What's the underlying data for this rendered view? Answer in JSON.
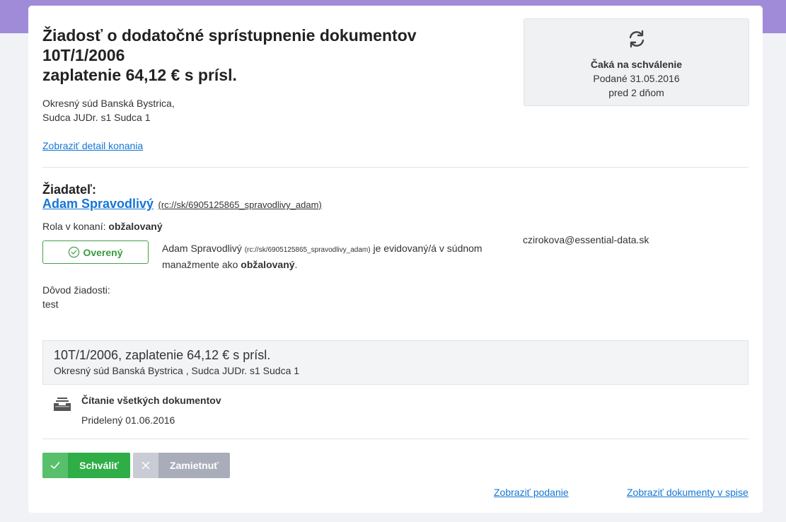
{
  "request": {
    "title_lines": [
      "Žiadosť o dodatočné sprístupnenie dokumentov",
      "10T/1/2006",
      "zaplatenie 64,12 € s prísl."
    ],
    "court_lines": [
      "Okresný súd Banská Bystrica,",
      "Sudca JUDr. s1 Sudca 1"
    ],
    "detail_link": "Zobraziť detail konania"
  },
  "status": {
    "icon": "refresh-icon",
    "title": "Čaká na schválenie",
    "date": "Podané 31.05.2016",
    "ago": "pred 2 dňom"
  },
  "applicant": {
    "heading": "Žiadateľ:",
    "name": "Adam Spravodlivý",
    "id": "(rc://sk/6905125865_spravodlivy_adam)",
    "role_label": "Rola v konaní:",
    "role_value": "obžalovaný",
    "verified_label": "Overený",
    "verified_color": "#46a049",
    "verify_name": "Adam Spravodlivý",
    "verify_id": "(rc://sk/6905125865_spravodlivy_adam)",
    "verify_text_1": "je evidovaný/á v súdnom manažmente ako",
    "verify_role": "obžalovaný",
    "verify_end": ".",
    "email": "czirokova@essential-data.sk",
    "reason_label": "Dôvod žiadosti:",
    "reason_value": "test"
  },
  "proceeding": {
    "title": "10T/1/2006, zaplatenie 64,12 € s prísl.",
    "subtitle": "Okresný súd Banská Bystrica , Sudca JUDr. s1 Sudca 1"
  },
  "document": {
    "icon": "inbox-tray-icon",
    "title": "Čítanie všetkých dokumentov",
    "assigned": "Pridelený 01.06.2016"
  },
  "actions": {
    "approve": "Schváliť",
    "reject": "Zamietnuť",
    "approve_color": "#2fae47",
    "reject_color": "#a9adba"
  },
  "links": {
    "show_submission": "Zobraziť podanie",
    "show_documents": "Zobraziť dokumenty v spise"
  },
  "colors": {
    "accent": "#a08bd9",
    "link": "#1476d6"
  }
}
